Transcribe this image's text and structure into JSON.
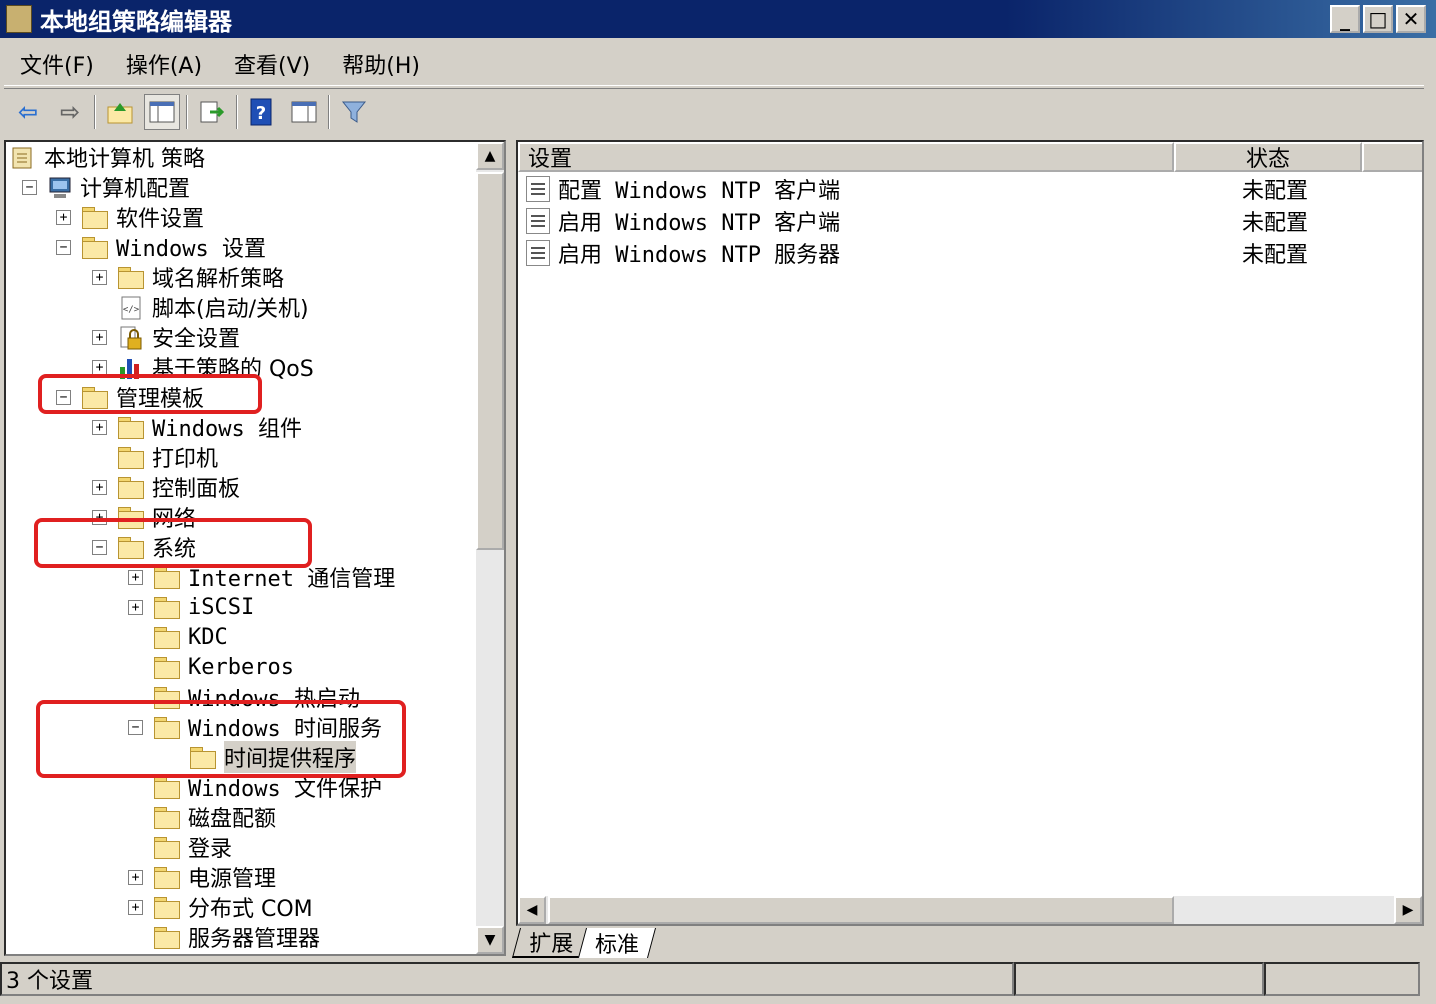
{
  "window": {
    "title": "本地组策略编辑器",
    "controls": {
      "minimize": "_",
      "maximize": "□",
      "close": "✕"
    }
  },
  "menu": [
    "文件(F)",
    "操作(A)",
    "查看(V)",
    "帮助(H)"
  ],
  "toolbar": {
    "buttons": [
      "back-icon",
      "forward-icon",
      "up-folder-icon",
      "show-hide-tree-icon",
      "export-list-icon",
      "help-icon",
      "show-action-pane-icon",
      "filter-icon"
    ]
  },
  "tree": {
    "root": "本地计算机 策略",
    "computer_config": "计算机配置",
    "software_settings": "软件设置",
    "windows_settings": "Windows 设置",
    "name_resolution_policy": "域名解析策略",
    "scripts": "脚本(启动/关机)",
    "security_settings": "安全设置",
    "policy_qos": "基于策略的 QoS",
    "admin_templates": "管理模板",
    "windows_components": "Windows 组件",
    "printers": "打印机",
    "control_panel": "控制面板",
    "network": "网络",
    "system": "系统",
    "internet_comm": "Internet 通信管理",
    "iscsi": "iSCSI",
    "kdc": "KDC",
    "kerberos": "Kerberos",
    "windows_hot_start": "Windows 热启动",
    "windows_time_service": "Windows 时间服务",
    "time_providers": "时间提供程序",
    "windows_file_protection": "Windows 文件保护",
    "disk_quota": "磁盘配额",
    "logon": "登录",
    "power_management": "电源管理",
    "distributed_com": "分布式 COM",
    "server_manager": "服务器管理器"
  },
  "list": {
    "columns": {
      "setting": "设置",
      "state": "状态"
    },
    "rows": [
      {
        "setting": "配置 Windows NTP 客户端",
        "state": "未配置"
      },
      {
        "setting": "启用 Windows NTP 客户端",
        "state": "未配置"
      },
      {
        "setting": "启用 Windows NTP 服务器",
        "state": "未配置"
      }
    ]
  },
  "tabs": {
    "extended": "扩展",
    "standard": "标准"
  },
  "status": {
    "count_text": "3 个设置"
  },
  "colors": {
    "highlight_box": "#e02020",
    "titlebar": "#0a246a"
  }
}
